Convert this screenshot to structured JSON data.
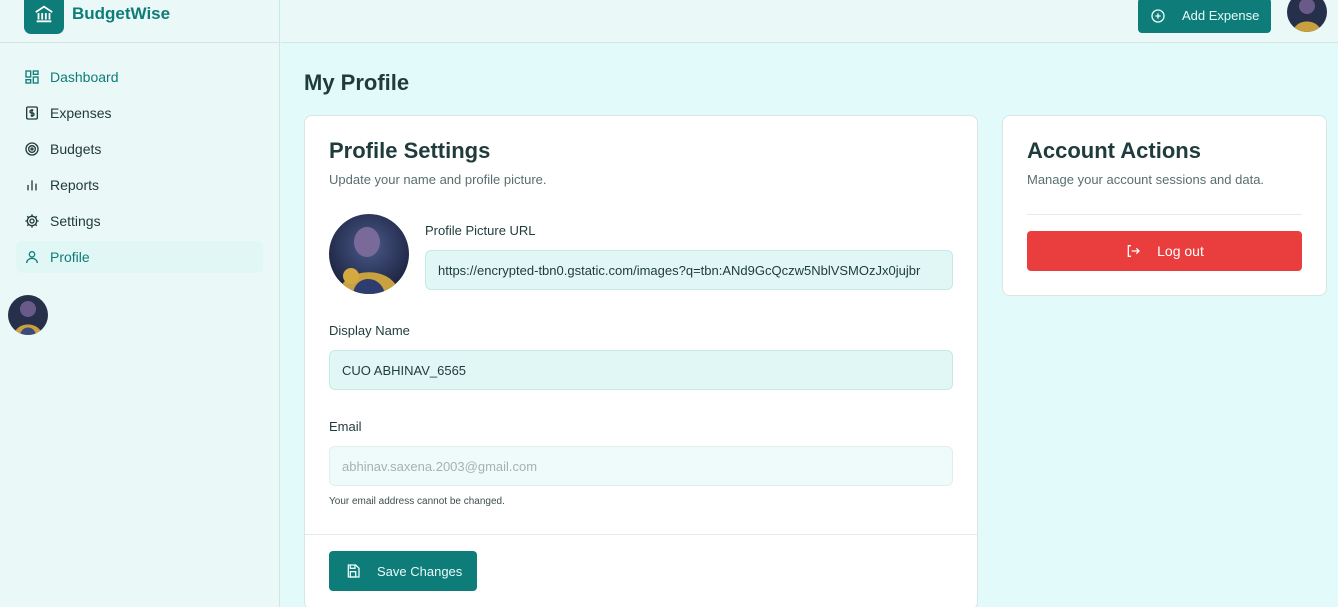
{
  "brand": {
    "name": "BudgetWise",
    "icon": "bank-icon"
  },
  "sidebar": {
    "items": [
      {
        "label": "Dashboard",
        "icon": "dashboard-icon"
      },
      {
        "label": "Expenses",
        "icon": "dollar-receipt-icon"
      },
      {
        "label": "Budgets",
        "icon": "target-icon"
      },
      {
        "label": "Reports",
        "icon": "bar-chart-icon"
      },
      {
        "label": "Settings",
        "icon": "gear-icon"
      },
      {
        "label": "Profile",
        "icon": "user-icon"
      }
    ],
    "active": "Profile"
  },
  "header": {
    "add_expense_label": "Add Expense"
  },
  "page": {
    "title": "My Profile"
  },
  "profile_card": {
    "title": "Profile Settings",
    "subtitle": "Update your name and profile picture.",
    "picture_url_label": "Profile Picture URL",
    "picture_url_value": "https://encrypted-tbn0.gstatic.com/images?q=tbn:ANd9GcQczw5NblVSMOzJx0jujbr",
    "display_name_label": "Display Name",
    "display_name_value": "CUO ABHINAV_6565",
    "email_label": "Email",
    "email_value": "abhinav.saxena.2003@gmail.com",
    "email_note": "Your email address cannot be changed.",
    "save_label": "Save Changes"
  },
  "actions_card": {
    "title": "Account Actions",
    "subtitle": "Manage your account sessions and data.",
    "logout_label": "Log out"
  },
  "colors": {
    "accent": "#0e7c78",
    "danger": "#ea3d3d",
    "background": "#e3fafa"
  }
}
